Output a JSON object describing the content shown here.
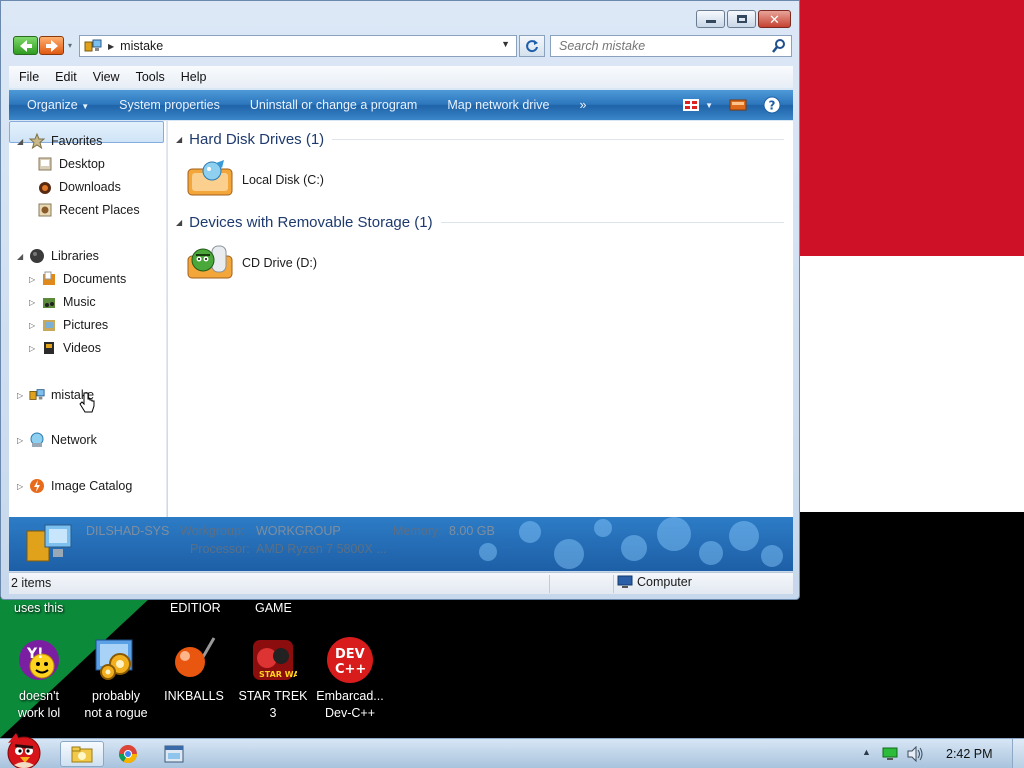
{
  "window": {
    "address": {
      "crumb": "mistake"
    },
    "search": {
      "placeholder": "Search mistake"
    },
    "menu": [
      "File",
      "Edit",
      "View",
      "Tools",
      "Help"
    ],
    "commands": [
      "Organize",
      "System properties",
      "Uninstall or change a program",
      "Map network drive",
      "»"
    ],
    "nav": {
      "favorites": "Favorites",
      "desktop": "Desktop",
      "downloads": "Downloads",
      "recent": "Recent Places",
      "libraries": "Libraries",
      "documents": "Documents",
      "music": "Music",
      "pictures": "Pictures",
      "videos": "Videos",
      "computer": "mistake",
      "network": "Network",
      "image_catalog": "Image Catalog"
    },
    "groups": {
      "hdd": {
        "title": "Hard Disk Drives (1)",
        "item": "Local Disk (C:)"
      },
      "removable": {
        "title": "Devices with Removable Storage (1)",
        "item": "CD Drive (D:)"
      }
    },
    "details": {
      "computer_name": "DILSHAD-SYS",
      "workgroup_label": "Workgroup:",
      "workgroup": "WORKGROUP",
      "memory_label": "Memory:",
      "memory": "8.00 GB",
      "processor_label": "Processor:",
      "processor": "AMD Ryzen 7 5800X ..."
    },
    "status": {
      "items": "2 items",
      "location": "Computer"
    }
  },
  "desktop": {
    "labels": {
      "uses_this": "uses this",
      "editor": "EDITIOR",
      "game": "GAME"
    },
    "icons": [
      {
        "line1": "doesn't",
        "line2": "work lol"
      },
      {
        "line1": "probably",
        "line2": "not a rogue"
      },
      {
        "line1": "INKBALLS",
        "line2": ""
      },
      {
        "line1": "STAR TREK",
        "line2": "3"
      },
      {
        "line1": "Embarcad...",
        "line2": "Dev-C++"
      }
    ]
  },
  "taskbar": {
    "clock": "2:42 PM"
  },
  "colors": {
    "flag_red": "#ce1126",
    "flag_white": "#ffffff",
    "flag_black": "#000000",
    "command_bar_blue": "#2c75bc"
  }
}
